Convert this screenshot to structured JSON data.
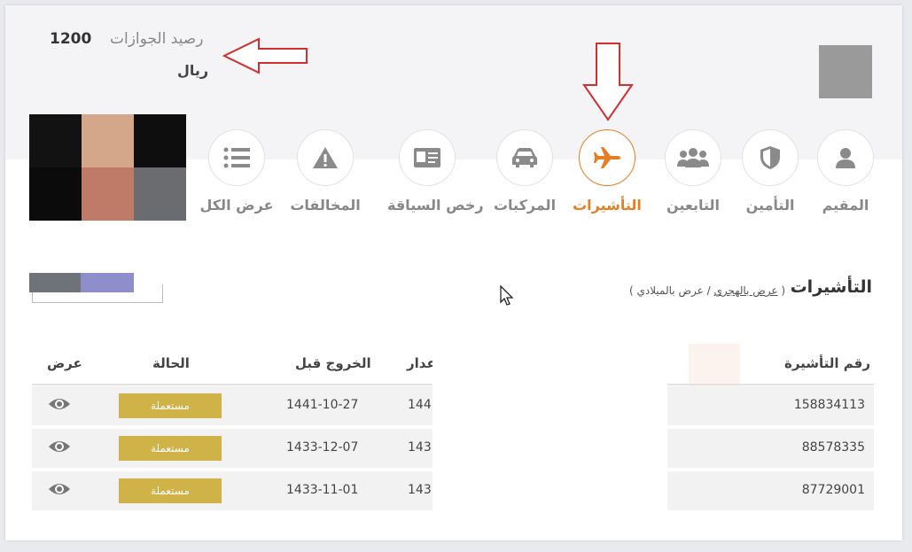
{
  "header": {
    "balance_label": "رصيد الجوازات",
    "balance_value": "1200",
    "currency": "ريال"
  },
  "categories": [
    {
      "label": "المقيم",
      "icon": "user-icon",
      "active": false
    },
    {
      "label": "التأمين",
      "icon": "shield-icon",
      "active": false
    },
    {
      "label": "التابعين",
      "icon": "users-icon",
      "active": false
    },
    {
      "label": "التأشيرات",
      "icon": "plane-icon",
      "active": true
    },
    {
      "label": "المركبات",
      "icon": "car-icon",
      "active": false
    },
    {
      "label": "رخص السياقة",
      "icon": "id-card-icon",
      "active": false
    },
    {
      "label": "المخالفات",
      "icon": "warning-icon",
      "active": false
    },
    {
      "label": "عرض الكل",
      "icon": "list-icon",
      "active": false
    }
  ],
  "section": {
    "title": "التأشيرات",
    "open_paren": "(",
    "toggle_hijri": "عرض بالهجري",
    "separator": "/",
    "toggle_gregorian": "عرض بالميلادي",
    "close_paren": ")"
  },
  "table": {
    "headers": {
      "visa_number": "رقم التأشيرة",
      "issue_partial": "عدار",
      "exit_before": "الخروج قبل",
      "status": "الحالة",
      "view": "عرض"
    },
    "rows": [
      {
        "visa_number": "158834113",
        "issue_partial": "144",
        "exit_before": "1441-10-27",
        "status": "مستعملة"
      },
      {
        "visa_number": "88578335",
        "issue_partial": "143",
        "exit_before": "1433-12-07",
        "status": "مستعملة"
      },
      {
        "visa_number": "87729001",
        "issue_partial": "143",
        "exit_before": "1433-11-01",
        "status": "مستعملة"
      }
    ]
  },
  "colors": {
    "accent": "#e67e22",
    "badge": "#cfb248",
    "annotation_arrow": "#d32f2f"
  }
}
